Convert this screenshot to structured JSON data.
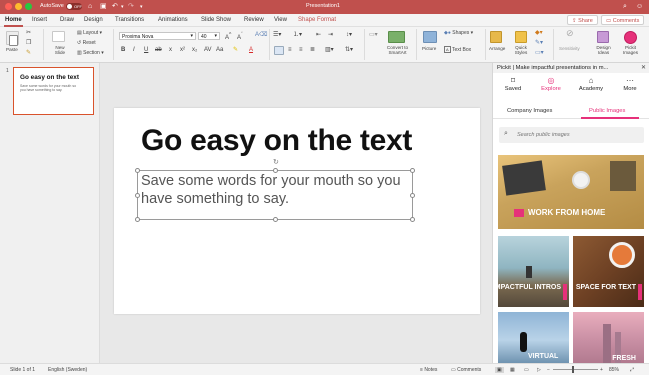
{
  "titlebar": {
    "autosave_label": "AutoSave",
    "autosave_state": "OFF",
    "document_title": "Presentation1",
    "colors": {
      "bar": "#c0504d",
      "close": "#ff5f57",
      "minimize": "#febc2e",
      "zoom": "#28c840"
    }
  },
  "tabs": {
    "items": [
      "Home",
      "Insert",
      "Draw",
      "Design",
      "Transitions",
      "Animations",
      "Slide Show",
      "Review",
      "View"
    ],
    "contextual": "Shape Format",
    "share": "Share",
    "comments": "Comments"
  },
  "ribbon": {
    "paste": "Paste",
    "new_slide": "New Slide",
    "layout": "Layout",
    "reset": "Reset",
    "section": "Section",
    "font_name": "Proxima Nova",
    "font_size": "40",
    "convert_to_smartart": "Convert to SmartArt",
    "picture": "Picture",
    "shapes": "Shapes",
    "text_box": "Text Box",
    "arrange": "Arrange",
    "quick_styles": "Quick Styles",
    "sensitivity": "Sensitivity",
    "design_ideas": "Design Ideas",
    "pickit_images": "Pickit Images"
  },
  "thumbnail": {
    "number": "1",
    "title": "Go easy on the text",
    "body": "Save some words for your mouth so you have something to say."
  },
  "slide": {
    "title": "Go easy on the text",
    "body": "Save some words for your mouth so you have something to say."
  },
  "pickit": {
    "header": "Pickit | Make impactful presentations in m...",
    "nav": [
      "Saved",
      "Explore",
      "Academy",
      "More"
    ],
    "tab_company": "Company Images",
    "tab_public": "Public Images",
    "search_placeholder": "Search public images",
    "images": [
      "WORK FROM HOME",
      "IMPACTFUL INTROS",
      "SPACE FOR TEXT",
      "VIRTUAL",
      "FRESH"
    ],
    "accent": "#e6317a"
  },
  "status": {
    "slide_of": "Slide 1 of 1",
    "language": "English (Sweden)",
    "notes": "Notes",
    "comments": "Comments",
    "zoom": "85%"
  }
}
